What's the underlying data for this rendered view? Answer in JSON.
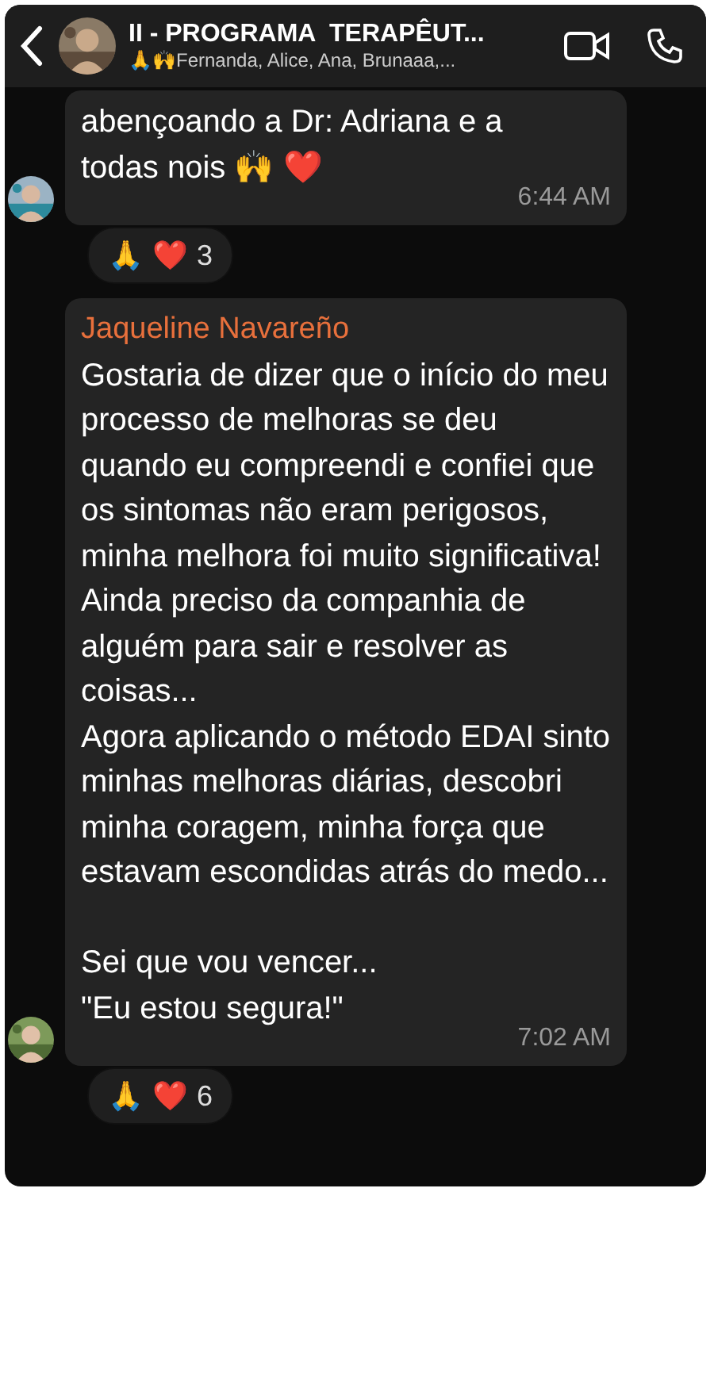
{
  "header": {
    "title": "II - PROGRAMA  TERAPÊUT...",
    "subtitle": "🙏🙌Fernanda, Alice, Ana, Brunaaa,..."
  },
  "messages": [
    {
      "text": "abençoando a Dr: Adriana e a\ntodas nois 🙌 ❤️",
      "time": "6:44 AM",
      "reactions": [
        "🙏",
        "❤️"
      ],
      "reaction_count": "3"
    },
    {
      "sender": "Jaqueline Navareño",
      "text": "Gostaria de dizer que o início do meu processo de melhoras se deu quando eu compreendi e confiei que os sintomas não eram perigosos, minha melhora foi muito significativa!\nAinda preciso da companhia de alguém para sair e resolver as coisas...\nAgora aplicando o método EDAI sinto minhas melhoras diárias, descobri minha coragem, minha força que estavam escondidas atrás do medo...\n\nSei que vou vencer...\n\"Eu estou segura!\"",
      "time": "7:02 AM",
      "reactions": [
        "🙏",
        "❤️"
      ],
      "reaction_count": "6"
    }
  ]
}
